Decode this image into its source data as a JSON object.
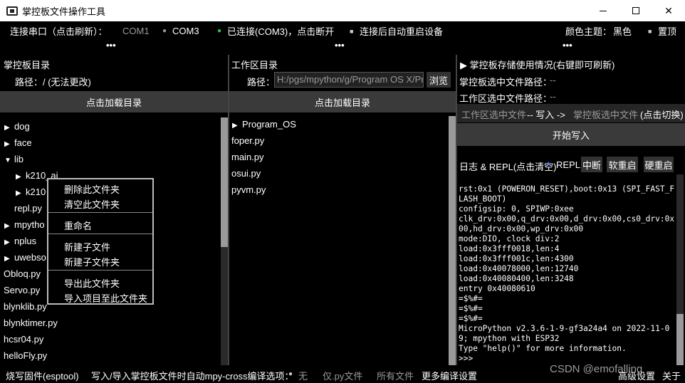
{
  "window": {
    "title": "掌控板文件操作工具",
    "minimize_label": "",
    "maximize_label": "",
    "close_label": "✕"
  },
  "topbar": {
    "port_label": "连接串口（点击刷新）：",
    "com1": "COM1",
    "com3": "COM3",
    "status": "已连接(COM3)，点击断开",
    "auto_restart": "连接后自动重启设备",
    "theme_label": "颜色主题：",
    "theme_value": "黑色",
    "pin_top": "置顶",
    "status_color": "#2ecc40"
  },
  "dots": "•••",
  "board_panel": {
    "title": "掌控板目录",
    "path_label": "路径：/ (无法更改)",
    "load_button": "点击加载目录",
    "tree": [
      {
        "label": "dog",
        "arrow": "▶"
      },
      {
        "label": "face",
        "arrow": "▶"
      },
      {
        "label": "lib",
        "arrow": "▼"
      },
      {
        "label": "k210_ai",
        "arrow": "▶"
      },
      {
        "label": "k210",
        "arrow": "▶"
      },
      {
        "label": "repl.py",
        "arrow": ""
      },
      {
        "label": "mpytho",
        "arrow": "▶"
      },
      {
        "label": "nplus",
        "arrow": "▶"
      },
      {
        "label": "uwebso",
        "arrow": "▶"
      },
      {
        "label": "Obloq.py",
        "arrow": ""
      },
      {
        "label": "Servo.py",
        "arrow": ""
      },
      {
        "label": "blynklib.py",
        "arrow": ""
      },
      {
        "label": "blynktimer.py",
        "arrow": ""
      },
      {
        "label": "hcsr04.py",
        "arrow": ""
      },
      {
        "label": "helloFly.py",
        "arrow": ""
      }
    ]
  },
  "context_menu": {
    "items": [
      "删除此文件夹",
      "清空此文件夹",
      "重命名",
      "新建子文件",
      "新建子文件夹",
      "导出此文件夹",
      "导入项目至此文件夹"
    ]
  },
  "work_panel": {
    "title": "工作区目录",
    "path_label": "路径：",
    "path_value": "H:/pgs/mpython/g/Program OS X/Program_OS",
    "browse_button": "浏览",
    "load_button": "点击加载目录",
    "tree": [
      {
        "label": "Program_OS",
        "arrow": "▶"
      },
      {
        "label": "foper.py",
        "arrow": ""
      },
      {
        "label": "main.py",
        "arrow": ""
      },
      {
        "label": "osui.py",
        "arrow": ""
      },
      {
        "label": "pyvm.py",
        "arrow": ""
      }
    ]
  },
  "right_panel": {
    "storage": "▶ 掌控板存储使用情况(右键即可刷新)",
    "board_selected_label": "掌控板选中文件路径：",
    "board_selected_value": "--",
    "work_selected_label": "工作区选中文件路径：",
    "work_selected_value": "--",
    "direction_from": "工作区选中文件",
    "direction_arrow": "-- 写入 ->",
    "direction_to": "掌控板选中文件",
    "direction_switch": "(点击切换)",
    "write_button": "开始写入",
    "log_label": "日志 & REPL(点击清空)",
    "repl_label": "REPL",
    "interrupt_button": "中断",
    "soft_reset_button": "软重启",
    "hard_reset_button": "硬重启",
    "log_lines": [
      "rst:0x1 (POWERON_RESET),boot:0x13 (SPI_FAST_FLASH_BOOT)",
      "configsip: 0, SPIWP:0xee",
      "clk_drv:0x00,q_drv:0x00,d_drv:0x00,cs0_drv:0x00,hd_drv:0x00,wp_drv:0x00",
      "mode:DIO, clock div:2",
      "load:0x3fff0018,len:4",
      "load:0x3fff001c,len:4300",
      "load:0x40078000,len:12740",
      "load:0x40080400,len:3248",
      "entry 0x40080610",
      "=$%#=",
      "=$%#=",
      "=$%#=",
      "MicroPython v2.3.6-1-9-gf3a24a4 on 2022-11-09; mpython with ESP32",
      "Type \"help()\" for more information.",
      ">>>"
    ]
  },
  "bottombar": {
    "flash": "烧写固件(esptool)",
    "compile_label": "写入/导入掌控板文件时自动mpy-cross编译选项：",
    "opt_none": "无",
    "opt_py": "仅.py文件",
    "opt_all": "所有文件",
    "more": "更多编译设置",
    "advanced": "高级设置",
    "about": "关于"
  },
  "watermark": "CSDN @emofalling"
}
